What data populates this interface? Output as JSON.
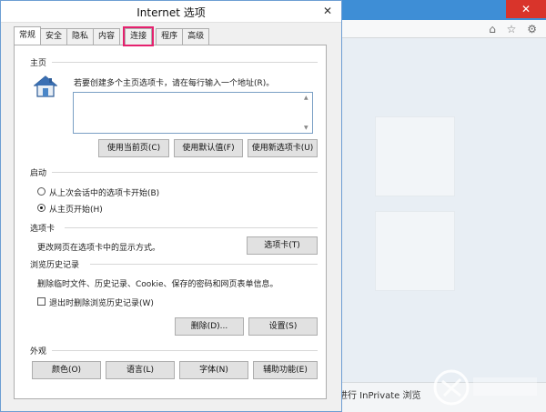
{
  "background_browser": {
    "close_glyph": "✕",
    "toolbar_icons": "⌂ ☆ ⚙",
    "inprivate_text": "进行 InPrivate 浏览"
  },
  "dialog": {
    "title": "Internet 选项",
    "close_glyph": "✕",
    "tabs": [
      {
        "label": "常规",
        "active": true
      },
      {
        "label": "安全"
      },
      {
        "label": "隐私"
      },
      {
        "label": "内容"
      },
      {
        "label": "连接",
        "highlighted": true
      },
      {
        "label": "程序"
      },
      {
        "label": "高级"
      }
    ],
    "homepage": {
      "section_label": "主页",
      "icon": "home-icon",
      "description": "若要创建多个主页选项卡，请在每行输入一个地址(R)。",
      "textarea_value": "",
      "buttons": {
        "use_current": "使用当前页(C)",
        "use_default": "使用默认值(F)",
        "use_new_tab": "使用新选项卡(U)"
      }
    },
    "startup": {
      "section_label": "启动",
      "option_last_session": "从上次会话中的选项卡开始(B)",
      "option_home": "从主页开始(H)",
      "selected": "option_home"
    },
    "tabs_section": {
      "section_label": "选项卡",
      "description": "更改网页在选项卡中的显示方式。",
      "button": "选项卡(T)"
    },
    "history": {
      "section_label": "浏览历史记录",
      "description": "删除临时文件、历史记录、Cookie、保存的密码和网页表单信息。",
      "checkbox_label": "退出时删除浏览历史记录(W)",
      "checkbox_checked": false,
      "delete_button": "删除(D)...",
      "settings_button": "设置(S)"
    },
    "appearance": {
      "section_label": "外观",
      "buttons": {
        "colors": "颜色(O)",
        "languages": "语言(L)",
        "fonts": "字体(N)",
        "accessibility": "辅助功能(E)"
      }
    }
  },
  "colors": {
    "tab_highlight": "#e5216e",
    "titlebar_accent": "#3e8ed6",
    "close_red": "#d9342b"
  }
}
